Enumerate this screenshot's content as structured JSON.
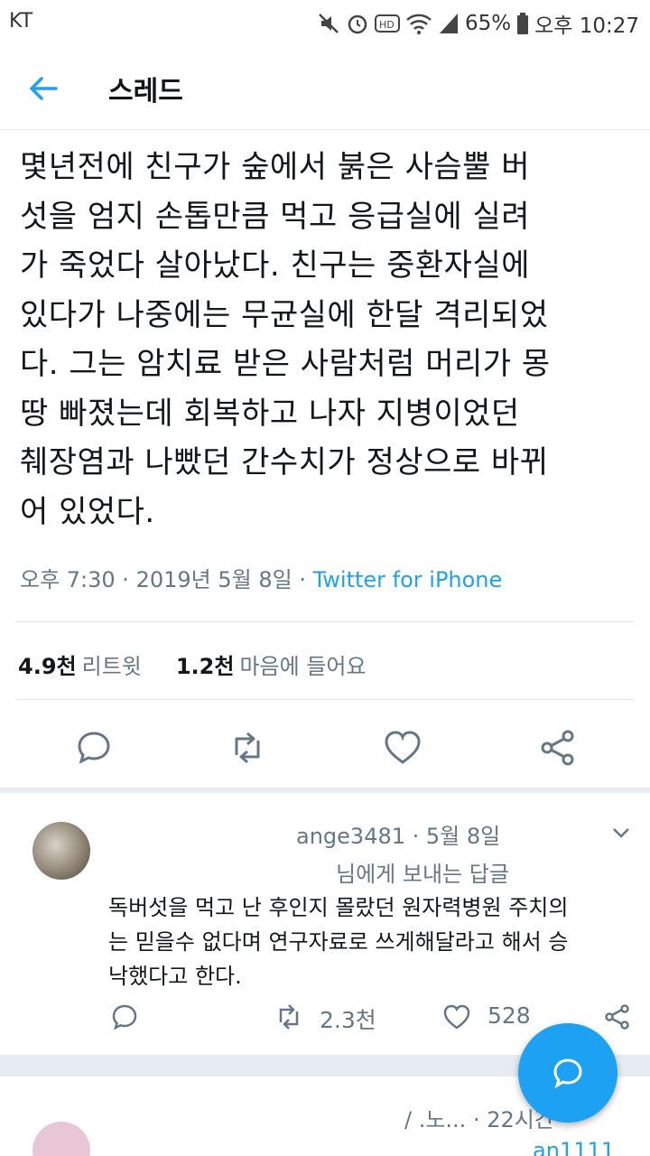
{
  "status_bar": {
    "carrier": "KT",
    "battery": "65%",
    "time": "오후 10:27",
    "icons": [
      "mute-icon",
      "alarm-icon",
      "hd-icon",
      "wifi-icon",
      "signal-icon",
      "battery-icon"
    ]
  },
  "header": {
    "title": "스레드",
    "back_icon": "back-arrow-icon"
  },
  "tweet": {
    "text": "몇년전에 친구가 숲에서 붉은 사슴뿔 버\n섯을 엄지 손톱만큼 먹고 응급실에 실려\n가 죽었다 살아났다. 친구는 중환자실에\n있다가 나중에는 무균실에 한달 격리되었\n다. 그는 암치료 받은 사람처럼 머리가 몽\n땅 빠졌는데 회복하고 나자 지병이었던\n췌장염과 나빴던 간수치가 정상으로 바뀌\n어 있었다.",
    "time": "오후 7:30 · 2019년 5월 8일 · ",
    "source": "Twitter for iPhone",
    "retweet_count": "4.9천",
    "retweet_label": "리트윗",
    "like_count": "1.2천",
    "like_label": "마음에 들어요"
  },
  "reply": {
    "handle": "ange3481 · 5월 8일",
    "replying_to": "님에게 보내는 답글",
    "text": "독버섯을 먹고 난 후인지 몰랐던 원자력병원 주치의\n는 믿을수 없다며 연구자료로 쓰게해달라고 해서 승\n낙했다고 한다.",
    "retweets": "2.3천",
    "likes": "528"
  },
  "reply2": {
    "handle": "/ .노... · 22시간",
    "handle2": "an1111"
  },
  "colors": {
    "accent": "#1da1f2",
    "text": "#14171a",
    "muted": "#657786"
  }
}
